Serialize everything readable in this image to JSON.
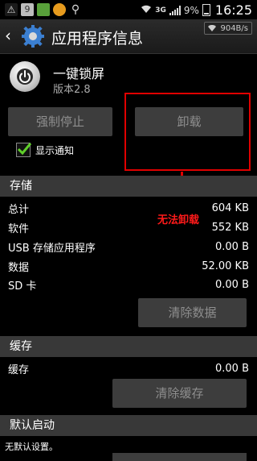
{
  "status_bar": {
    "network": "3G",
    "battery": "9%",
    "time": "16:25"
  },
  "title_bar": {
    "title": "应用程序信息",
    "speed": "904B/s"
  },
  "app": {
    "name": "一键锁屏",
    "version": "版本2.8"
  },
  "buttons": {
    "force_stop": "强制停止",
    "uninstall": "卸载",
    "clear_data": "清除数据",
    "clear_cache": "清除缓存"
  },
  "notification": {
    "label": "显示通知",
    "checked": true
  },
  "annotation": {
    "label": "无法卸载"
  },
  "storage": {
    "header": "存储",
    "rows": [
      {
        "label": "总计",
        "value": "604 KB"
      },
      {
        "label": "软件",
        "value": "552 KB"
      },
      {
        "label": "USB 存储应用程序",
        "value": "0.00 B"
      },
      {
        "label": "数据",
        "value": "52.00 KB"
      },
      {
        "label": "SD 卡",
        "value": "0.00 B"
      }
    ]
  },
  "cache": {
    "header": "缓存",
    "row": {
      "label": "缓存",
      "value": "0.00 B"
    }
  },
  "default_launch": {
    "header": "默认启动",
    "text": "无默认设置。"
  }
}
